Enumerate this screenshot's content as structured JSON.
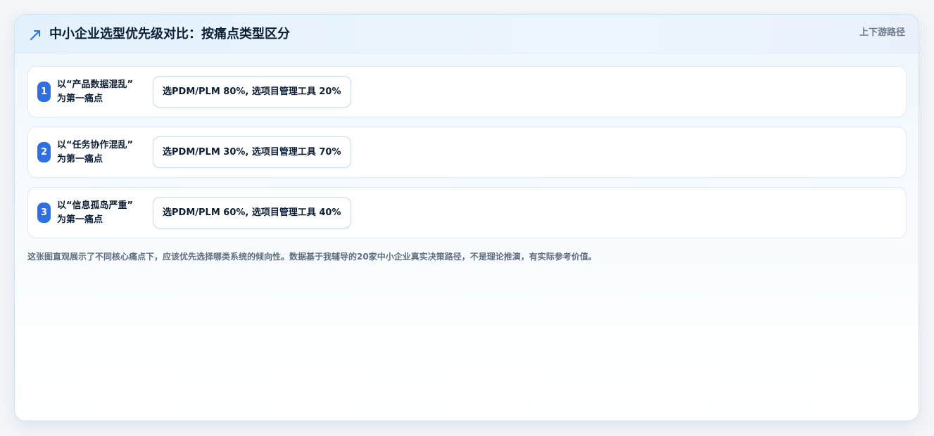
{
  "header": {
    "title": "中小企业选型优先级对比：按痛点类型区分",
    "icon": "trending-arrow-icon",
    "link_label": "上下游路径"
  },
  "rows": [
    {
      "index": "1",
      "label_line1": "以“产品数据混乱”",
      "label_line2": "为第一痛点",
      "result": "选PDM/PLM 80%, 选项目管理工具 20%"
    },
    {
      "index": "2",
      "label_line1": "以“任务协作混乱”",
      "label_line2": "为第一痛点",
      "result": "选PDM/PLM 30%, 选项目管理工具 70%"
    },
    {
      "index": "3",
      "label_line1": "以“信息孤岛严重”",
      "label_line2": "为第一痛点",
      "result": "选PDM/PLM 60%, 选项目管理工具 40%"
    }
  ],
  "footnote": "这张图直观展示了不同核心痛点下，应该优先选择哪类系统的倾向性。数据基于我辅导的20家中小企业真实决策路径，不是理论推演，有实际参考价值。",
  "colors": {
    "accent": "#2f6fe0",
    "title": "#0d1f35",
    "muted": "#6b7a8c"
  }
}
